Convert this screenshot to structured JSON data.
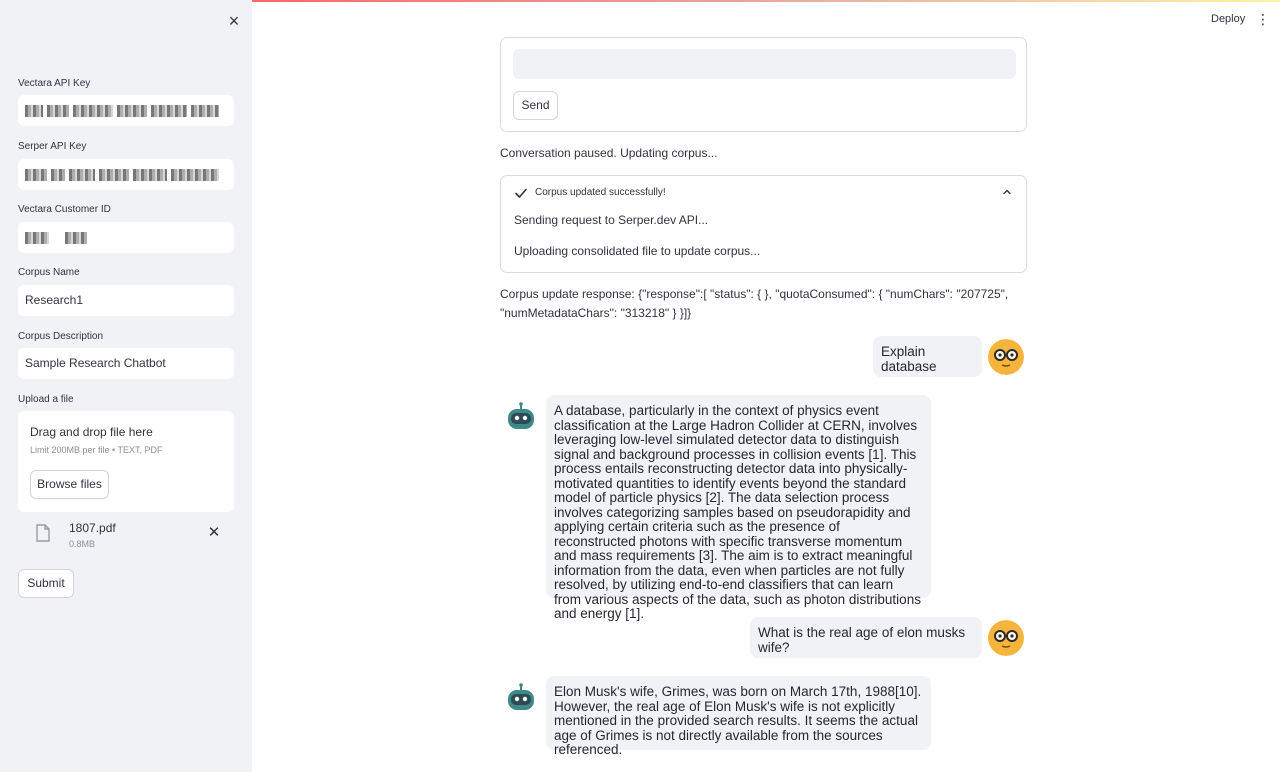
{
  "sidebar": {
    "close_label": "×",
    "vectara_api_key_label": "Vectara API Key",
    "serper_api_key_label": "Serper API Key",
    "customer_id_label": "Vectara Customer ID",
    "corpus_name_label": "Corpus Name",
    "corpus_name_value": "Research1",
    "corpus_description_label": "Corpus Description",
    "corpus_description_value": "Sample Research Chatbot",
    "upload_label": "Upload a file",
    "dropzone_title": "Drag and drop file here",
    "dropzone_limit": "Limit 200MB per file • TEXT, PDF",
    "browse_label": "Browse files",
    "uploaded_file": {
      "name": "1807.pdf",
      "size": "0.8MB"
    },
    "submit_label": "Submit"
  },
  "header": {
    "deploy_label": "Deploy",
    "menu_icon": "⋮"
  },
  "form": {
    "input_value": "",
    "send_label": "Send"
  },
  "status_text": "Conversation paused. Updating corpus...",
  "expander": {
    "title": "Corpus updated successfully!",
    "line1": "Sending request to Serper.dev API...",
    "line2": "Uploading consolidated file to update corpus..."
  },
  "corpus_response": "Corpus update response: {\"response\":[ \"status\": { }, \"quotaConsumed\": { \"numChars\": \"207725\", \"numMetadataChars\": \"313218\" } }]}",
  "chat": {
    "user_msg_1": "Explain database",
    "bot_msg_1": "A database, particularly in the context of physics event classification at the Large Hadron Collider at CERN, involves leveraging low-level simulated detector data to distinguish signal and background processes in collision events [1]. This process entails reconstructing detector data into physically-motivated quantities to identify events beyond the standard model of particle physics [2]. The data selection process involves categorizing samples based on pseudorapidity and applying certain criteria such as the presence of reconstructed photons with specific transverse momentum and mass requirements [3]. The aim is to extract meaningful information from the data, even when particles are not fully resolved, by utilizing end-to-end classifiers that can learn from various aspects of the data, such as photon distributions and energy [1].",
    "user_msg_2": "What is the real age of elon musks wife?",
    "bot_msg_2": "Elon Musk's wife, Grimes, was born on March 17th, 1988[10]. However, the real age of Elon Musk's wife is not explicitly mentioned in the provided search results. It seems the actual age of Grimes is not directly available from the sources referenced."
  },
  "colors": {
    "accent": "#ff4b4b",
    "sidebar_bg": "#f0f2f6",
    "bubble_bg": "#f0f2f6",
    "user_avatar": "#f5b43b",
    "bot_avatar": "#3f8a86"
  }
}
